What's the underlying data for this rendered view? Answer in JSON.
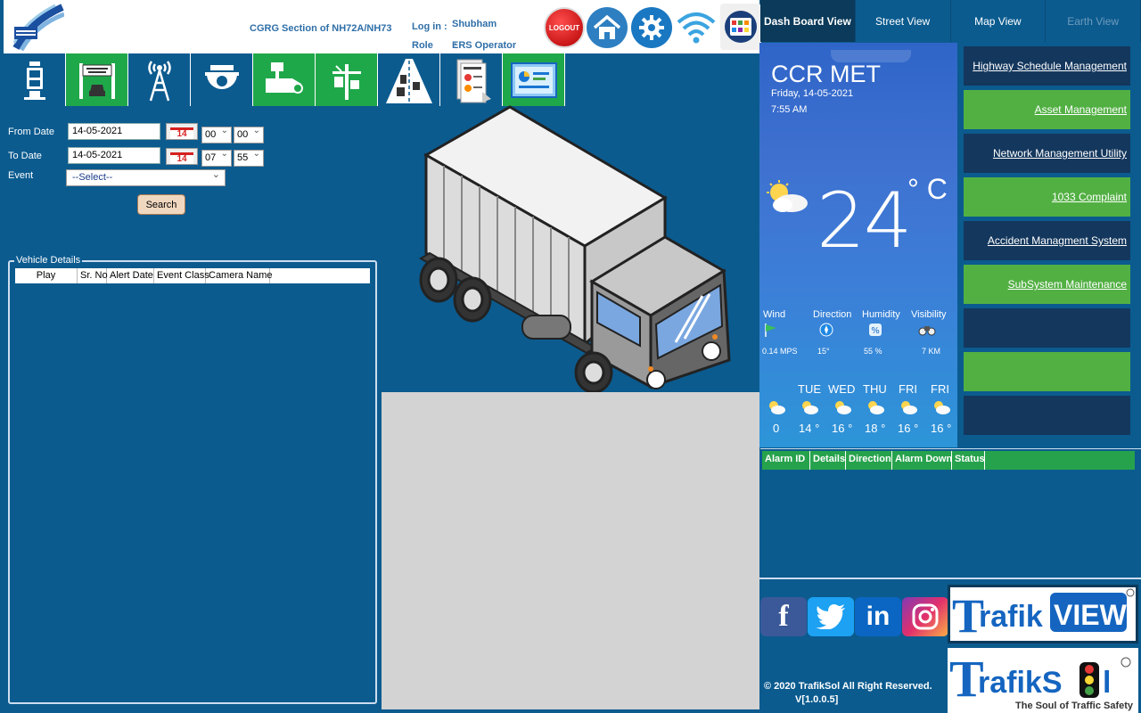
{
  "header": {
    "section_title": "CGRG Section of NH72A/NH73",
    "login_label": "Log in :",
    "login_user": "Shubham",
    "role_label": "Role",
    "role_sep": ":",
    "role_value": "ERS Operator",
    "logout_label": "LOGOUT"
  },
  "filters": {
    "from_label": "From Date",
    "from_date": "14-05-2021",
    "from_hour": "00",
    "from_min": "00",
    "to_label": "To Date",
    "to_date": "14-05-2021",
    "to_hour": "07",
    "to_min": "55",
    "calendar_day": "14",
    "event_label": "Event",
    "event_value": "--Select--",
    "search_label": "Search"
  },
  "vehicle_details": {
    "title": "Vehicle Details",
    "columns": [
      "Play",
      "Sr. No",
      "Alert Date",
      "Event Class",
      "Camera Name"
    ]
  },
  "tabs": [
    {
      "label": "Dash Board View"
    },
    {
      "label": "Street View"
    },
    {
      "label": "Map View"
    },
    {
      "label": "Earth View"
    }
  ],
  "weather": {
    "title": "CCR MET",
    "date": "Friday, 14-05-2021",
    "time": "7:55 AM",
    "temp": "24",
    "unit": "° C",
    "stats": [
      {
        "label": "Wind",
        "value": "0.14 MPS",
        "icon": "wind-flag-icon"
      },
      {
        "label": "Direction",
        "value": "15°",
        "icon": "compass-icon"
      },
      {
        "label": "Humidity",
        "value": "55 %",
        "icon": "humidity-icon"
      },
      {
        "label": "Visibility",
        "value": "7 KM",
        "icon": "binoculars-icon"
      }
    ],
    "forecast": [
      {
        "day": "",
        "temp": "0"
      },
      {
        "day": "TUE",
        "temp": "14 °"
      },
      {
        "day": "WED",
        "temp": "16 °"
      },
      {
        "day": "THU",
        "temp": "18 °"
      },
      {
        "day": "FRI",
        "temp": "16 °"
      },
      {
        "day": "FRI",
        "temp": "16 °"
      }
    ]
  },
  "links": [
    {
      "label": "Highway Schedule Management",
      "style": "dark"
    },
    {
      "label": "Asset Management",
      "style": "green"
    },
    {
      "label": "Network Management Utility",
      "style": "dark"
    },
    {
      "label": "1033 Complaint",
      "style": "green"
    },
    {
      "label": "Accident Managment System",
      "style": "dark"
    },
    {
      "label": "SubSystem Maintenance",
      "style": "green"
    },
    {
      "label": "",
      "style": "dark"
    },
    {
      "label": "",
      "style": "green"
    },
    {
      "label": "",
      "style": "dark"
    }
  ],
  "alarm": {
    "columns": [
      "Alarm ID",
      "Details",
      "Direction",
      "Alarm Down",
      "Status"
    ]
  },
  "footer": {
    "copyright": "© 2020 TrafikSol All Right Reserved.",
    "version": "V[1.0.0.5]",
    "brand_view_a": "rafik",
    "brand_view_b": "VIEW",
    "brand_sol_a": "rafikS",
    "brand_sol_b": "l",
    "brand_tagline": "The Soul of Traffic Safety"
  },
  "colors": {
    "background": "#0b5b8f",
    "accent_green": "#1fa84a",
    "link_green": "#52b043",
    "link_dark": "#14375d"
  }
}
